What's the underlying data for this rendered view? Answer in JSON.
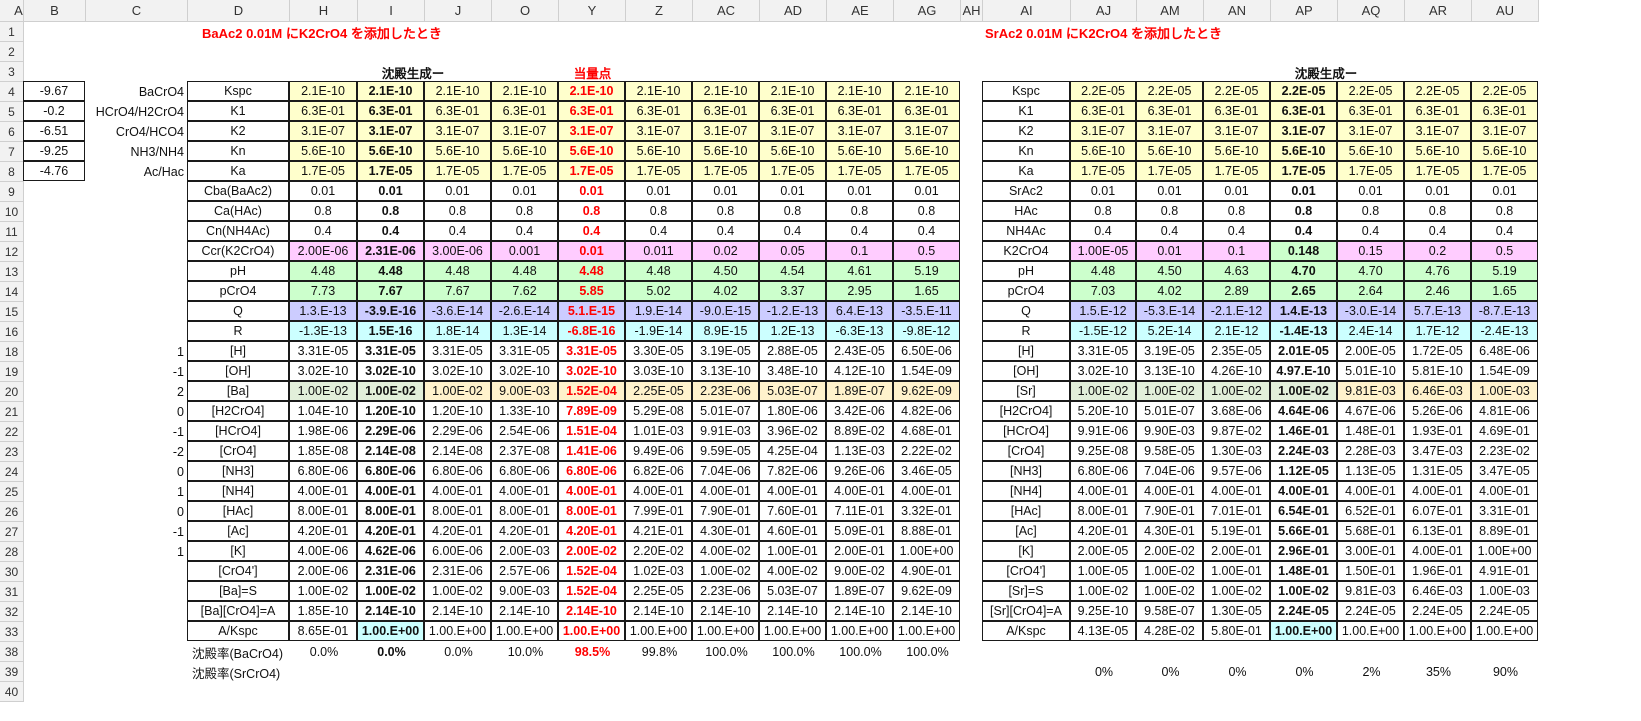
{
  "colHeaders": [
    "A",
    "B",
    "C",
    "D",
    "H",
    "I",
    "J",
    "O",
    "Y",
    "Z",
    "AC",
    "AD",
    "AE",
    "AG",
    "AH",
    "AI",
    "AJ",
    "AM",
    "AN",
    "AP",
    "AQ",
    "AR",
    "AU"
  ],
  "rowNums": [
    "1",
    "2",
    "3",
    "4",
    "5",
    "6",
    "7",
    "8",
    "9",
    "10",
    "11",
    "12",
    "13",
    "14",
    "15",
    "16",
    "18",
    "19",
    "20",
    "21",
    "22",
    "23",
    "24",
    "25",
    "26",
    "27",
    "28",
    "30",
    "31",
    "32",
    "33",
    "38",
    "39",
    "40"
  ],
  "titles": {
    "left": "BaAc2 0.01M にK2CrO4 を添加したとき",
    "right": "SrAc2 0.01M にK2CrO4 を添加したとき",
    "leftOnset": "沈殿生成ー",
    "equiv": "当量点",
    "rightOnset": "沈殿生成ー"
  },
  "constB": [
    "-9.67",
    "-0.2",
    "-6.51",
    "-9.25",
    "-4.76"
  ],
  "constC": [
    "BaCrO4",
    "HCrO4/H2CrO4",
    "CrO4/HCO4",
    "NH3/NH4",
    "Ac/Hac"
  ],
  "chargesC": [
    "1",
    "-1",
    "2",
    "0",
    "-1",
    "-2",
    "0",
    "1",
    "0",
    "-1",
    "1"
  ],
  "leftLabels": [
    "Kspc",
    "K1",
    "K2",
    "Kn",
    "Ka",
    "Cba(BaAc2)",
    "Ca(HAc)",
    "Cn(NH4Ac)",
    "Ccr(K2CrO4)",
    "pH",
    "pCrO4",
    "Q",
    "R",
    "[H]",
    "[OH]",
    "[Ba]",
    "[H2CrO4]",
    "[HCrO4]",
    "[CrO4]",
    "[NH3]",
    "[NH4]",
    "[HAc]",
    "[Ac]",
    "[K]",
    "[CrO4']",
    "[Ba]=S",
    "[Ba][CrO4]=A",
    "A/Kspc"
  ],
  "rightLabels": [
    "Kspc",
    "K1",
    "K2",
    "Kn",
    "Ka",
    "SrAc2",
    "HAc",
    "NH4Ac",
    "K2CrO4",
    "pH",
    "pCrO4",
    "Q",
    "R",
    "[H]",
    "[OH]",
    "[Sr]",
    "[H2CrO4]",
    "[HCrO4]",
    "[CrO4]",
    "[NH3]",
    "[NH4]",
    "[HAc]",
    "[Ac]",
    "[K]",
    "[CrO4']",
    "[Sr]=S",
    "[Sr][CrO4]=A",
    "A/Kspc"
  ],
  "leftRows": [
    [
      "2.1E-10",
      "2.1E-10",
      "2.1E-10",
      "2.1E-10",
      "2.1E-10",
      "2.1E-10",
      "2.1E-10",
      "2.1E-10",
      "2.1E-10",
      "2.1E-10"
    ],
    [
      "6.3E-01",
      "6.3E-01",
      "6.3E-01",
      "6.3E-01",
      "6.3E-01",
      "6.3E-01",
      "6.3E-01",
      "6.3E-01",
      "6.3E-01",
      "6.3E-01"
    ],
    [
      "3.1E-07",
      "3.1E-07",
      "3.1E-07",
      "3.1E-07",
      "3.1E-07",
      "3.1E-07",
      "3.1E-07",
      "3.1E-07",
      "3.1E-07",
      "3.1E-07"
    ],
    [
      "5.6E-10",
      "5.6E-10",
      "5.6E-10",
      "5.6E-10",
      "5.6E-10",
      "5.6E-10",
      "5.6E-10",
      "5.6E-10",
      "5.6E-10",
      "5.6E-10"
    ],
    [
      "1.7E-05",
      "1.7E-05",
      "1.7E-05",
      "1.7E-05",
      "1.7E-05",
      "1.7E-05",
      "1.7E-05",
      "1.7E-05",
      "1.7E-05",
      "1.7E-05"
    ],
    [
      "0.01",
      "0.01",
      "0.01",
      "0.01",
      "0.01",
      "0.01",
      "0.01",
      "0.01",
      "0.01",
      "0.01"
    ],
    [
      "0.8",
      "0.8",
      "0.8",
      "0.8",
      "0.8",
      "0.8",
      "0.8",
      "0.8",
      "0.8",
      "0.8"
    ],
    [
      "0.4",
      "0.4",
      "0.4",
      "0.4",
      "0.4",
      "0.4",
      "0.4",
      "0.4",
      "0.4",
      "0.4"
    ],
    [
      "2.00E-06",
      "2.31E-06",
      "3.00E-06",
      "0.001",
      "0.01",
      "0.011",
      "0.02",
      "0.05",
      "0.1",
      "0.5"
    ],
    [
      "4.48",
      "4.48",
      "4.48",
      "4.48",
      "4.48",
      "4.48",
      "4.50",
      "4.54",
      "4.61",
      "5.19"
    ],
    [
      "7.73",
      "7.67",
      "7.67",
      "7.62",
      "5.85",
      "5.02",
      "4.02",
      "3.37",
      "2.95",
      "1.65"
    ],
    [
      "1.3.E-13",
      "-3.9.E-16",
      "-3.6.E-14",
      "-2.6.E-14",
      "5.1.E-15",
      "1.9.E-14",
      "-9.0.E-15",
      "-1.2.E-13",
      "6.4.E-13",
      "-3.5.E-11"
    ],
    [
      "-1.3E-13",
      "1.5E-16",
      "1.8E-14",
      "1.3E-14",
      "-6.8E-16",
      "-1.9E-14",
      "8.9E-15",
      "1.2E-13",
      "-6.3E-13",
      "-9.8E-12"
    ],
    [
      "3.31E-05",
      "3.31E-05",
      "3.31E-05",
      "3.31E-05",
      "3.31E-05",
      "3.30E-05",
      "3.19E-05",
      "2.88E-05",
      "2.43E-05",
      "6.50E-06"
    ],
    [
      "3.02E-10",
      "3.02E-10",
      "3.02E-10",
      "3.02E-10",
      "3.02E-10",
      "3.03E-10",
      "3.13E-10",
      "3.48E-10",
      "4.12E-10",
      "1.54E-09"
    ],
    [
      "1.00E-02",
      "1.00E-02",
      "1.00E-02",
      "9.00E-03",
      "1.52E-04",
      "2.25E-05",
      "2.23E-06",
      "5.03E-07",
      "1.89E-07",
      "9.62E-09"
    ],
    [
      "1.04E-10",
      "1.20E-10",
      "1.20E-10",
      "1.33E-10",
      "7.89E-09",
      "5.29E-08",
      "5.01E-07",
      "1.80E-06",
      "3.42E-06",
      "4.82E-06"
    ],
    [
      "1.98E-06",
      "2.29E-06",
      "2.29E-06",
      "2.54E-06",
      "1.51E-04",
      "1.01E-03",
      "9.91E-03",
      "3.96E-02",
      "8.89E-02",
      "4.68E-01"
    ],
    [
      "1.85E-08",
      "2.14E-08",
      "2.14E-08",
      "2.37E-08",
      "1.41E-06",
      "9.49E-06",
      "9.59E-05",
      "4.25E-04",
      "1.13E-03",
      "2.22E-02"
    ],
    [
      "6.80E-06",
      "6.80E-06",
      "6.80E-06",
      "6.80E-06",
      "6.80E-06",
      "6.82E-06",
      "7.04E-06",
      "7.82E-06",
      "9.26E-06",
      "3.46E-05"
    ],
    [
      "4.00E-01",
      "4.00E-01",
      "4.00E-01",
      "4.00E-01",
      "4.00E-01",
      "4.00E-01",
      "4.00E-01",
      "4.00E-01",
      "4.00E-01",
      "4.00E-01"
    ],
    [
      "8.00E-01",
      "8.00E-01",
      "8.00E-01",
      "8.00E-01",
      "8.00E-01",
      "7.99E-01",
      "7.90E-01",
      "7.60E-01",
      "7.11E-01",
      "3.32E-01"
    ],
    [
      "4.20E-01",
      "4.20E-01",
      "4.20E-01",
      "4.20E-01",
      "4.20E-01",
      "4.21E-01",
      "4.30E-01",
      "4.60E-01",
      "5.09E-01",
      "8.88E-01"
    ],
    [
      "4.00E-06",
      "4.62E-06",
      "6.00E-06",
      "2.00E-03",
      "2.00E-02",
      "2.20E-02",
      "4.00E-02",
      "1.00E-01",
      "2.00E-01",
      "1.00E+00"
    ],
    [
      "2.00E-06",
      "2.31E-06",
      "2.31E-06",
      "2.57E-06",
      "1.52E-04",
      "1.02E-03",
      "1.00E-02",
      "4.00E-02",
      "9.00E-02",
      "4.90E-01"
    ],
    [
      "1.00E-02",
      "1.00E-02",
      "1.00E-02",
      "9.00E-03",
      "1.52E-04",
      "2.25E-05",
      "2.23E-06",
      "5.03E-07",
      "1.89E-07",
      "9.62E-09"
    ],
    [
      "1.85E-10",
      "2.14E-10",
      "2.14E-10",
      "2.14E-10",
      "2.14E-10",
      "2.14E-10",
      "2.14E-10",
      "2.14E-10",
      "2.14E-10",
      "2.14E-10"
    ],
    [
      "8.65E-01",
      "1.00.E+00",
      "1.00.E+00",
      "1.00.E+00",
      "1.00.E+00",
      "1.00.E+00",
      "1.00.E+00",
      "1.00.E+00",
      "1.00.E+00",
      "1.00.E+00"
    ]
  ],
  "rightRows": [
    [
      "2.2E-05",
      "2.2E-05",
      "2.2E-05",
      "2.2E-05",
      "2.2E-05",
      "2.2E-05",
      "2.2E-05"
    ],
    [
      "6.3E-01",
      "6.3E-01",
      "6.3E-01",
      "6.3E-01",
      "6.3E-01",
      "6.3E-01",
      "6.3E-01"
    ],
    [
      "3.1E-07",
      "3.1E-07",
      "3.1E-07",
      "3.1E-07",
      "3.1E-07",
      "3.1E-07",
      "3.1E-07"
    ],
    [
      "5.6E-10",
      "5.6E-10",
      "5.6E-10",
      "5.6E-10",
      "5.6E-10",
      "5.6E-10",
      "5.6E-10"
    ],
    [
      "1.7E-05",
      "1.7E-05",
      "1.7E-05",
      "1.7E-05",
      "1.7E-05",
      "1.7E-05",
      "1.7E-05"
    ],
    [
      "0.01",
      "0.01",
      "0.01",
      "0.01",
      "0.01",
      "0.01",
      "0.01"
    ],
    [
      "0.8",
      "0.8",
      "0.8",
      "0.8",
      "0.8",
      "0.8",
      "0.8"
    ],
    [
      "0.4",
      "0.4",
      "0.4",
      "0.4",
      "0.4",
      "0.4",
      "0.4"
    ],
    [
      "1.00E-05",
      "0.01",
      "0.1",
      "0.148",
      "0.15",
      "0.2",
      "0.5"
    ],
    [
      "4.48",
      "4.50",
      "4.63",
      "4.70",
      "4.70",
      "4.76",
      "5.19"
    ],
    [
      "7.03",
      "4.02",
      "2.89",
      "2.65",
      "2.64",
      "2.46",
      "1.65"
    ],
    [
      "1.5.E-12",
      "-5.3.E-14",
      "-2.1.E-12",
      "1.4.E-13",
      "-3.0.E-14",
      "5.7.E-13",
      "-8.7.E-13"
    ],
    [
      "-1.5E-12",
      "5.2E-14",
      "2.1E-12",
      "-1.4E-13",
      "2.4E-14",
      "1.7E-12",
      "-2.4E-13"
    ],
    [
      "3.31E-05",
      "3.19E-05",
      "2.35E-05",
      "2.01E-05",
      "2.00E-05",
      "1.72E-05",
      "6.48E-06"
    ],
    [
      "3.02E-10",
      "3.13E-10",
      "4.26E-10",
      "4.97.E-10",
      "5.01E-10",
      "5.81E-10",
      "1.54E-09"
    ],
    [
      "1.00E-02",
      "1.00E-02",
      "1.00E-02",
      "1.00E-02",
      "9.81E-03",
      "6.46E-03",
      "1.00E-03"
    ],
    [
      "5.20E-10",
      "5.01E-07",
      "3.68E-06",
      "4.64E-06",
      "4.67E-06",
      "5.26E-06",
      "4.81E-06"
    ],
    [
      "9.91E-06",
      "9.90E-03",
      "9.87E-02",
      "1.46E-01",
      "1.48E-01",
      "1.93E-01",
      "4.69E-01"
    ],
    [
      "9.25E-08",
      "9.58E-05",
      "1.30E-03",
      "2.24E-03",
      "2.28E-03",
      "3.47E-03",
      "2.23E-02"
    ],
    [
      "6.80E-06",
      "7.04E-06",
      "9.57E-06",
      "1.12E-05",
      "1.13E-05",
      "1.31E-05",
      "3.47E-05"
    ],
    [
      "4.00E-01",
      "4.00E-01",
      "4.00E-01",
      "4.00E-01",
      "4.00E-01",
      "4.00E-01",
      "4.00E-01"
    ],
    [
      "8.00E-01",
      "7.90E-01",
      "7.01E-01",
      "6.54E-01",
      "6.52E-01",
      "6.07E-01",
      "3.31E-01"
    ],
    [
      "4.20E-01",
      "4.30E-01",
      "5.19E-01",
      "5.66E-01",
      "5.68E-01",
      "6.13E-01",
      "8.89E-01"
    ],
    [
      "2.00E-05",
      "2.00E-02",
      "2.00E-01",
      "2.96E-01",
      "3.00E-01",
      "4.00E-01",
      "1.00E+00"
    ],
    [
      "1.00E-05",
      "1.00E-02",
      "1.00E-01",
      "1.48E-01",
      "1.50E-01",
      "1.96E-01",
      "4.91E-01"
    ],
    [
      "1.00E-02",
      "1.00E-02",
      "1.00E-02",
      "1.00E-02",
      "9.81E-03",
      "6.46E-03",
      "1.00E-03"
    ],
    [
      "9.25E-10",
      "9.58E-07",
      "1.30E-05",
      "2.24E-05",
      "2.24E-05",
      "2.24E-05",
      "2.24E-05"
    ],
    [
      "4.13E-05",
      "4.28E-02",
      "5.80E-01",
      "1.00.E+00",
      "1.00.E+00",
      "1.00.E+00",
      "1.00.E+00"
    ]
  ],
  "row38": {
    "label": "沈殿率(BaCrO4)",
    "values": [
      "0.0%",
      "0.0%",
      "0.0%",
      "10.0%",
      "98.5%",
      "99.8%",
      "100.0%",
      "100.0%",
      "100.0%",
      "100.0%"
    ]
  },
  "row39": {
    "label": "沈殿率(SrCrO4)",
    "values": [
      "0%",
      "0%",
      "0%",
      "0%",
      "2%",
      "35%",
      "90%"
    ]
  },
  "colors": {
    "yellow": "#ffffcc",
    "pink": "#ffccff",
    "green": "#ccffcc",
    "violet": "#ccccff",
    "cyan": "#ccffff",
    "lightgreen": "#e2efda",
    "tan": "#fff2cc",
    "highlight": "#ccffff"
  }
}
